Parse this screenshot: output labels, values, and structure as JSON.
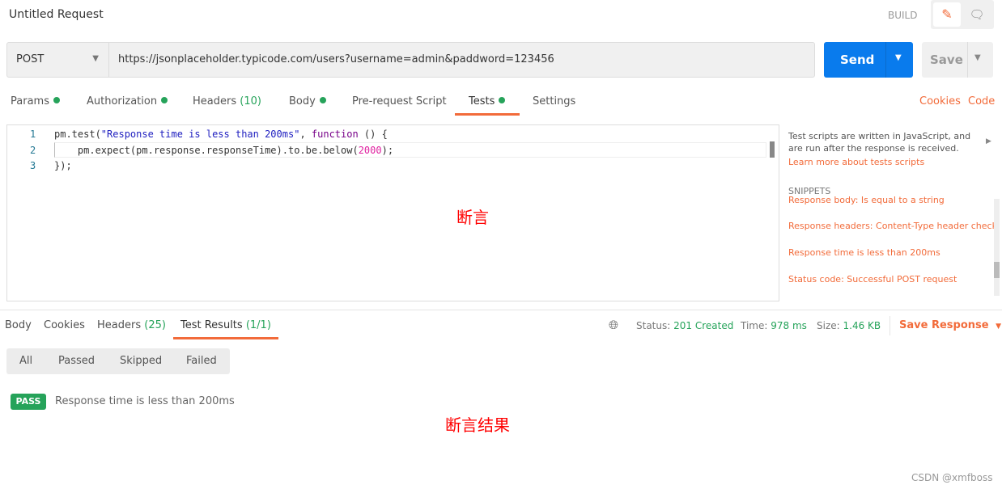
{
  "header": {
    "title": "Untitled Request",
    "mode": "BUILD"
  },
  "request": {
    "method": "POST",
    "url": "https://jsonplaceholder.typicode.com/users?username=admin&paddword=123456",
    "send": "Send",
    "save": "Save"
  },
  "tabs": [
    {
      "label": "Params"
    },
    {
      "label": "Authorization"
    },
    {
      "label": "Headers",
      "count": "(10)"
    },
    {
      "label": "Body"
    },
    {
      "label": "Pre-request Script"
    },
    {
      "label": "Tests"
    },
    {
      "label": "Settings"
    }
  ],
  "links": {
    "cookies": "Cookies",
    "code": "Code"
  },
  "editor": {
    "line_numbers": [
      "1",
      "2",
      "3"
    ],
    "l1a": "pm.test(",
    "l1b": "\"Response time is less than 200ms\"",
    "l1c": ", ",
    "l1d": "function",
    "l1e": " () {",
    "l2a": "    pm.expect(pm.response.responseTime).to.be.below(",
    "l2b": "2000",
    "l2c": ");",
    "l3": "});"
  },
  "annotation1": "断言",
  "annotation2": "断言结果",
  "sidebar": {
    "desc": "Test scripts are written in JavaScript, and are run after the response is received.",
    "learn": "Learn more about tests scripts",
    "snippets_title": "SNIPPETS",
    "snippets": [
      "Response body: Is equal to a string",
      "Response headers: Content-Type header check",
      "Response time is less than 200ms",
      "Status code: Successful POST request"
    ]
  },
  "response": {
    "tabs": [
      {
        "label": "Body"
      },
      {
        "label": "Cookies"
      },
      {
        "label": "Headers",
        "count": "(25)"
      },
      {
        "label": "Test Results",
        "count": "(1/1)"
      }
    ],
    "status_label": "Status:",
    "status": "201 Created",
    "time_label": "Time:",
    "time": "978 ms",
    "size_label": "Size:",
    "size": "1.46 KB",
    "save_response": "Save Response"
  },
  "filters": [
    "All",
    "Passed",
    "Skipped",
    "Failed"
  ],
  "results": [
    {
      "badge": "PASS",
      "name": "Response time is less than 200ms"
    }
  ],
  "watermark": "CSDN @xmfboss",
  "colors": {
    "accent": "#f26b3a",
    "send": "#097bed",
    "success": "#26a35a"
  }
}
